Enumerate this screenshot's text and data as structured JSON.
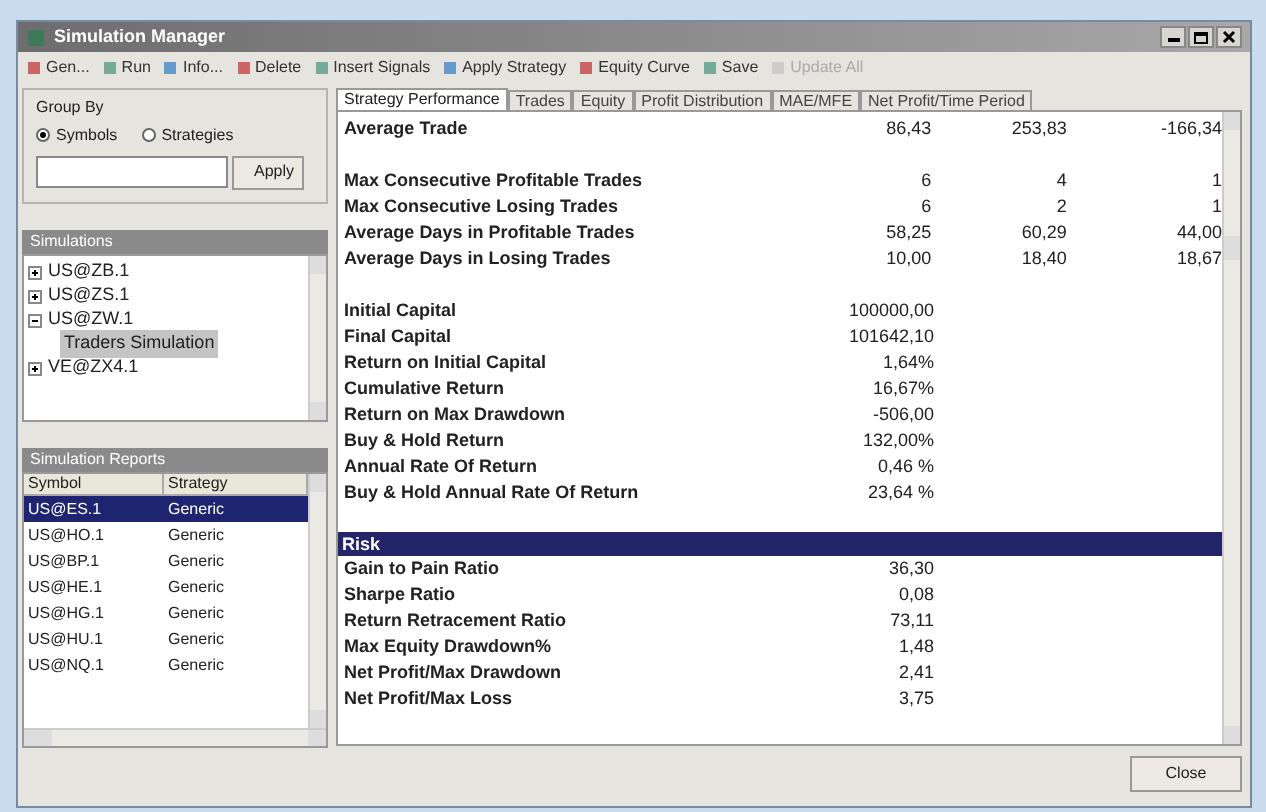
{
  "window": {
    "title": "Simulation Manager"
  },
  "toolbar": [
    {
      "label": "Gen...",
      "disabled": false
    },
    {
      "label": "Run",
      "disabled": false
    },
    {
      "label": "Info...",
      "disabled": false
    },
    {
      "label": "Delete",
      "disabled": false
    },
    {
      "label": "Insert Signals",
      "disabled": false
    },
    {
      "label": "Apply Strategy",
      "disabled": false
    },
    {
      "label": "Equity Curve",
      "disabled": false
    },
    {
      "label": "Save",
      "disabled": false
    },
    {
      "label": "Update All",
      "disabled": true
    }
  ],
  "group_by": {
    "title": "Group By",
    "options": [
      {
        "label": "Symbols",
        "selected": true
      },
      {
        "label": "Strategies",
        "selected": false
      }
    ],
    "apply_button": "Apply"
  },
  "simulations": {
    "title": "Simulations",
    "tree": [
      {
        "label": "US@ZB.1",
        "expanded": false,
        "selected": false
      },
      {
        "label": "US@ZS.1",
        "expanded": false,
        "selected": false
      },
      {
        "label": "US@ZW.1",
        "expanded": true,
        "selected": false,
        "children": [
          {
            "label": "Traders Simulation",
            "selected": true
          }
        ]
      },
      {
        "label": "VE@ZX4.1",
        "expanded": false,
        "selected": false
      }
    ]
  },
  "reports": {
    "title": "Simulation Reports",
    "columns": [
      "Symbol",
      "Strategy"
    ],
    "rows": [
      {
        "cells": [
          "US@ES.1",
          "Generic"
        ],
        "selected": true
      },
      {
        "cells": [
          "US@HO.1",
          "Generic"
        ],
        "selected": false
      },
      {
        "cells": [
          "US@BP.1",
          "Generic"
        ],
        "selected": false
      },
      {
        "cells": [
          "US@HE.1",
          "Generic"
        ],
        "selected": false
      },
      {
        "cells": [
          "US@HG.1",
          "Generic"
        ],
        "selected": false
      },
      {
        "cells": [
          "US@HU.1",
          "Generic"
        ],
        "selected": false
      },
      {
        "cells": [
          "US@NQ.1",
          "Generic"
        ],
        "selected": false
      }
    ]
  },
  "tabs": [
    {
      "label": "Strategy Performance",
      "selected": true
    },
    {
      "label": "Trades",
      "selected": false
    },
    {
      "label": "Equity",
      "selected": false
    },
    {
      "label": "Profit Distribution",
      "selected": false
    },
    {
      "label": "MAE/MFE",
      "selected": false
    },
    {
      "label": "Net Profit/Time Period",
      "selected": false
    }
  ],
  "groups": [
    {
      "rows": [
        {
          "label": "Average Trade",
          "values": [
            "86,43",
            "253,83",
            "-166,34"
          ]
        }
      ]
    },
    {
      "rows": [
        {
          "label": "Max Consecutive Profitable Trades",
          "values": [
            "6",
            "4",
            "1"
          ]
        },
        {
          "label": "Max Consecutive Losing Trades",
          "values": [
            "6",
            "2",
            "1"
          ]
        },
        {
          "label": "Average Days in Profitable Trades",
          "values": [
            "58,25",
            "60,29",
            "44,00"
          ]
        },
        {
          "label": "Average Days in Losing Trades",
          "values": [
            "10,00",
            "18,40",
            "18,67"
          ]
        }
      ]
    },
    {
      "rows": [
        {
          "label": "Initial Capital",
          "values": [
            "100000,00"
          ]
        },
        {
          "label": "Final Capital",
          "values": [
            "101642,10"
          ]
        },
        {
          "label": "Return on Initial Capital",
          "values": [
            "1,64%"
          ]
        },
        {
          "label": "Cumulative Return",
          "values": [
            "16,67%"
          ]
        },
        {
          "label": "Return on Max Drawdown",
          "values": [
            "-506,00"
          ]
        },
        {
          "label": "Buy & Hold Return",
          "values": [
            "132,00%"
          ]
        },
        {
          "label": "Annual Rate Of Return",
          "values": [
            "0,46 %"
          ]
        },
        {
          "label": "Buy & Hold Annual Rate Of Return",
          "values": [
            "23,64 %"
          ]
        }
      ]
    },
    {
      "title": "Risk",
      "rows": [
        {
          "label": "Gain to Pain Ratio",
          "values": [
            "36,30"
          ]
        },
        {
          "label": "Sharpe Ratio",
          "values": [
            "0,08"
          ]
        },
        {
          "label": "Return Retracement Ratio",
          "values": [
            "73,11"
          ]
        },
        {
          "label": "Max Equity Drawdown%",
          "values": [
            "1,48"
          ]
        },
        {
          "label": "Net Profit/Max Drawdown",
          "values": [
            "2,41"
          ]
        },
        {
          "label": "Net Profit/Max Loss",
          "values": [
            "3,75"
          ]
        }
      ]
    }
  ],
  "close_button": "Close"
}
